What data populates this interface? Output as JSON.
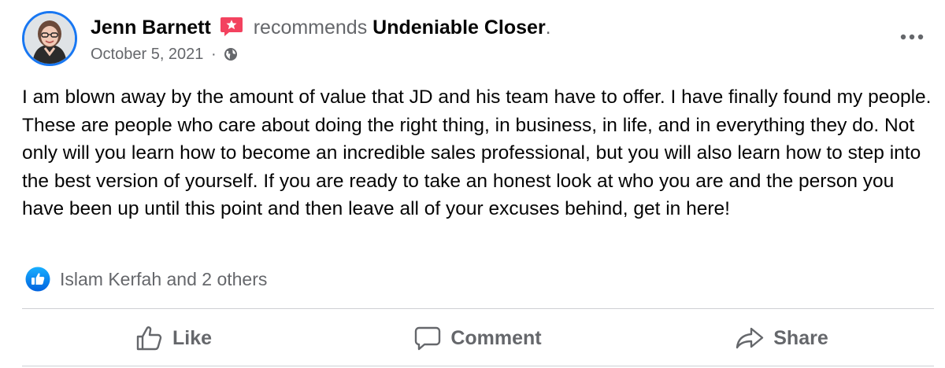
{
  "post": {
    "author": "Jenn Barnett",
    "verb": "recommends",
    "page": "Undeniable Closer",
    "period": ".",
    "date": "October 5, 2021",
    "separator": "·",
    "body": "I am blown away by the amount of value that JD and his team have to offer. I have finally found my people. These are people who care about doing the right thing, in business, in life, and in everything they do. Not only will you learn how to become an incredible sales professional, but you will also learn how to step into the best version of yourself. If you are ready to take an honest look at who you are and the person you have been up until this point and then leave all of your excuses behind, get in here!"
  },
  "reactions": {
    "summary": "Islam Kerfah and 2 others"
  },
  "actions": {
    "like": "Like",
    "comment": "Comment",
    "share": "Share"
  },
  "colors": {
    "brand_blue": "#1877f2",
    "secondary_text": "#65676b",
    "recommend_badge": "#f3425f"
  }
}
